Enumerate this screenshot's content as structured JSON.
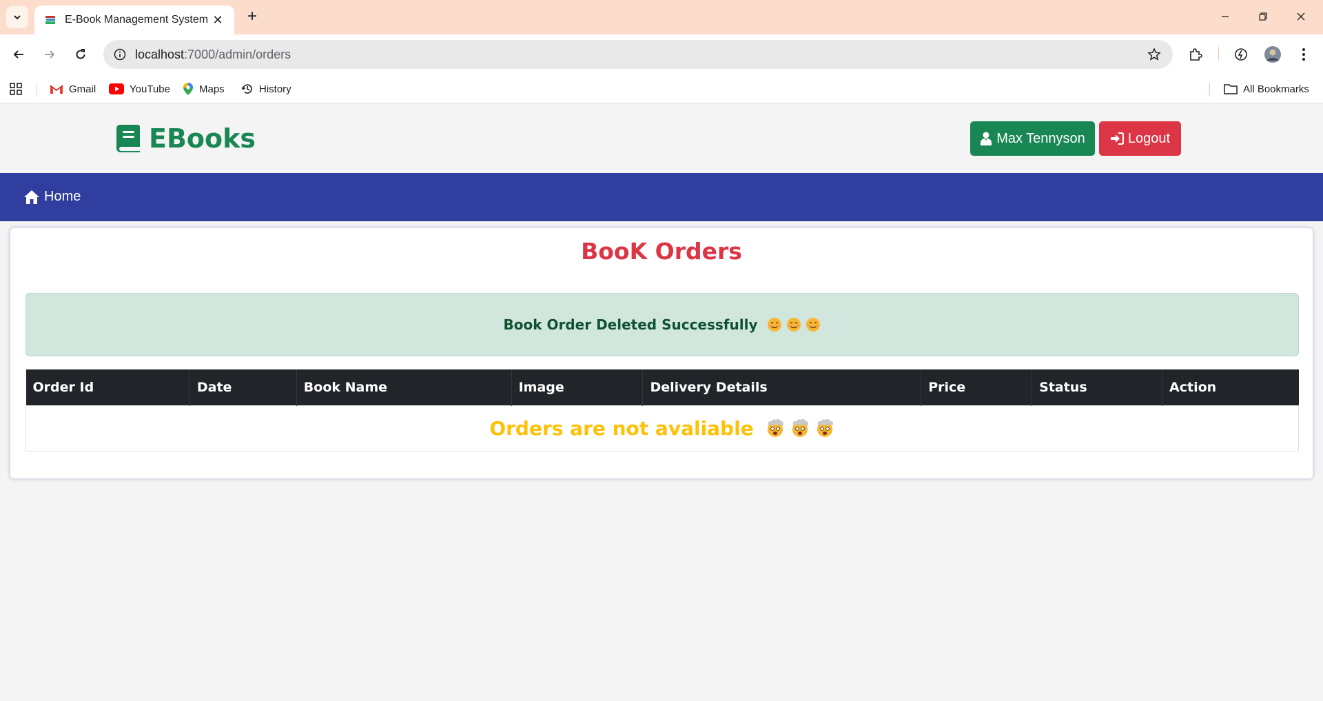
{
  "browser": {
    "tab_title": "E-Book Management System",
    "new_tab_label": "+",
    "url_host": "localhost",
    "url_path": ":7000/admin/orders",
    "bookmarks": [
      {
        "label": "Gmail",
        "icon": "gmail-icon"
      },
      {
        "label": "YouTube",
        "icon": "youtube-icon"
      },
      {
        "label": "Maps",
        "icon": "maps-icon"
      },
      {
        "label": "History",
        "icon": "history-icon"
      }
    ],
    "all_bookmarks_label": "All Bookmarks"
  },
  "header": {
    "brand_name": "EBooks",
    "user_name": "Max Tennyson",
    "logout_label": "Logout"
  },
  "nav": {
    "home_label": "Home"
  },
  "main": {
    "title": "BooK Orders",
    "alert_message": "Book Order Deleted Successfully",
    "table": {
      "columns": [
        "Order Id",
        "Date",
        "Book Name",
        "Image",
        "Delivery Details",
        "Price",
        "Status",
        "Action"
      ],
      "empty_message": "Orders are not avaliable"
    }
  },
  "colors": {
    "brand_green": "#198754",
    "danger_red": "#dc3545",
    "nav_blue": "#303e9f",
    "warning_yellow": "#ffc107",
    "alert_bg": "#d1e7dd",
    "table_header_bg": "#212529"
  }
}
